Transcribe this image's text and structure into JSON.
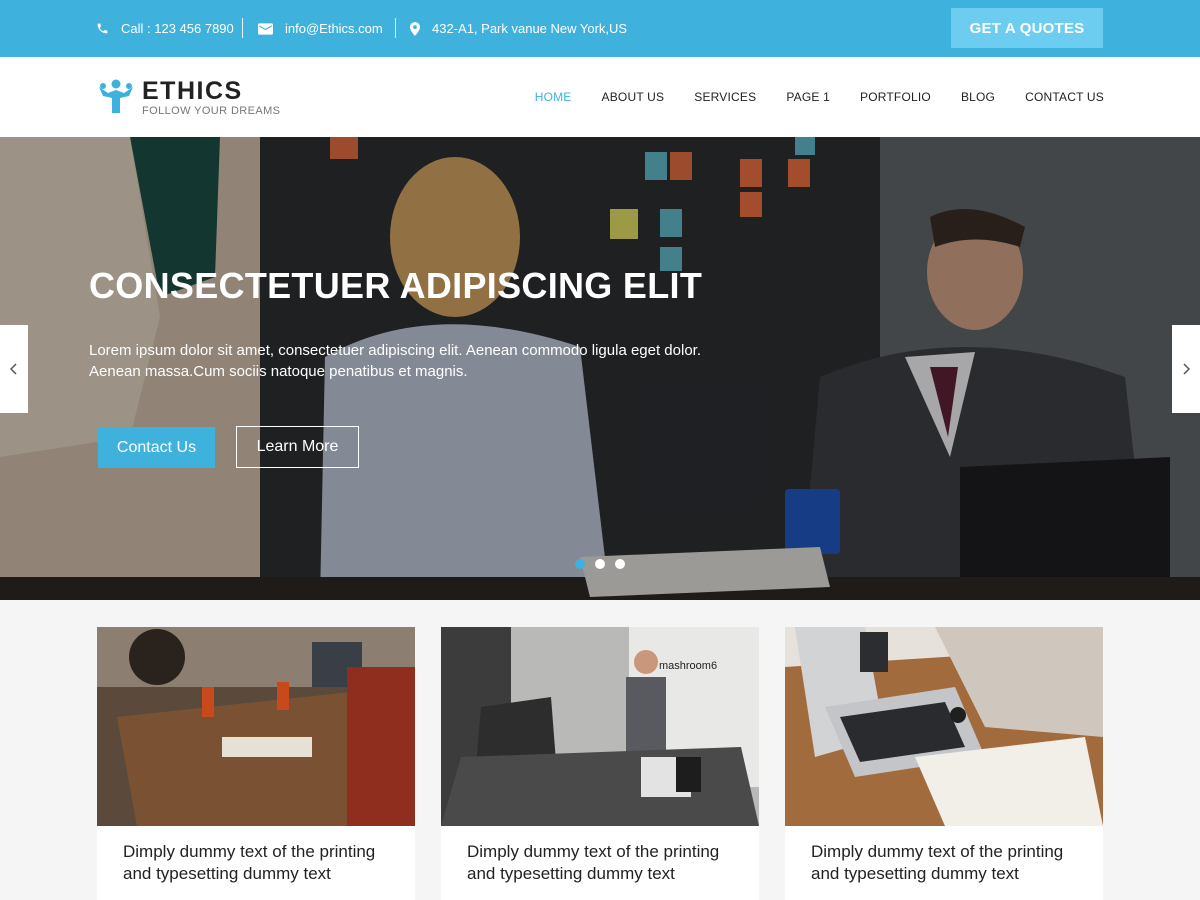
{
  "topbar": {
    "phone": "Call : 123 456 7890",
    "email": "info@Ethics.com",
    "address": "432-A1, Park vanue New York,US",
    "quote_button": "GET A QUOTES"
  },
  "logo": {
    "name": "ETHICS",
    "tagline": "FOLLOW YOUR DREAMS",
    "icon": "logo-figure-icon"
  },
  "nav": {
    "items": [
      "HOME",
      "ABOUT US",
      "SERVICES",
      "PAGE 1",
      "PORTFOLIO",
      "BLOG",
      "CONTACT US"
    ],
    "active": "HOME"
  },
  "hero": {
    "title": "CONSECTETUER ADIPISCING ELIT",
    "text_line1": "Lorem ipsum dolor sit amet, consectetuer adipiscing elit. Aenean commodo ligula eget dolor.",
    "text_line2": "Aenean massa.Cum sociis natoque penatibus et magnis.",
    "primary_button": "Contact Us",
    "secondary_button": "Learn More",
    "prev_icon": "chevron-left-icon",
    "next_icon": "chevron-right-icon",
    "slide_count": 3,
    "active_slide": 1
  },
  "cards": [
    {
      "line1": "Dimply dummy text of the printing",
      "line2": "and typesetting dummy text"
    },
    {
      "line1": "Dimply dummy text of the printing",
      "line2": "and typesetting dummy text"
    },
    {
      "line1": "Dimply dummy text of the printing",
      "line2": "and typesetting dummy text"
    }
  ],
  "colors": {
    "accent": "#3eb2dc",
    "quote_button": "#6dcdf1",
    "text_dark": "#222222"
  }
}
